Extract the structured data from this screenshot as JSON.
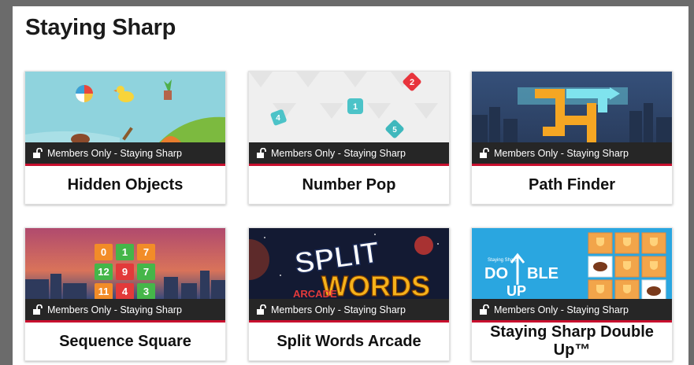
{
  "section": {
    "title": "Staying Sharp"
  },
  "cards": [
    {
      "title": "Hidden Objects",
      "badge": "Members Only - Staying Sharp"
    },
    {
      "title": "Number Pop",
      "badge": "Members Only - Staying Sharp",
      "tile_numbers": [
        "1",
        "2",
        "4",
        "5"
      ]
    },
    {
      "title": "Path Finder",
      "badge": "Members Only - Staying Sharp"
    },
    {
      "title": "Sequence Square",
      "badge": "Members Only - Staying Sharp",
      "grid_numbers": [
        "0",
        "1",
        "7",
        "12",
        "9",
        "7",
        "11",
        "4",
        "3"
      ]
    },
    {
      "title": "Split Words Arcade",
      "badge": "Members Only - Staying Sharp",
      "logo_text": [
        "SPLIT",
        "WORDS",
        "ARCADE"
      ]
    },
    {
      "title": "Staying Sharp Double Up™",
      "badge": "Members Only - Staying Sharp",
      "logo_text": [
        "Staying Sharp",
        "DO",
        "BLE",
        "UP"
      ]
    }
  ],
  "colors": {
    "accent_red": "#c8102e",
    "badge_bg": "#262626",
    "page_frame": "#6b6b6b"
  }
}
